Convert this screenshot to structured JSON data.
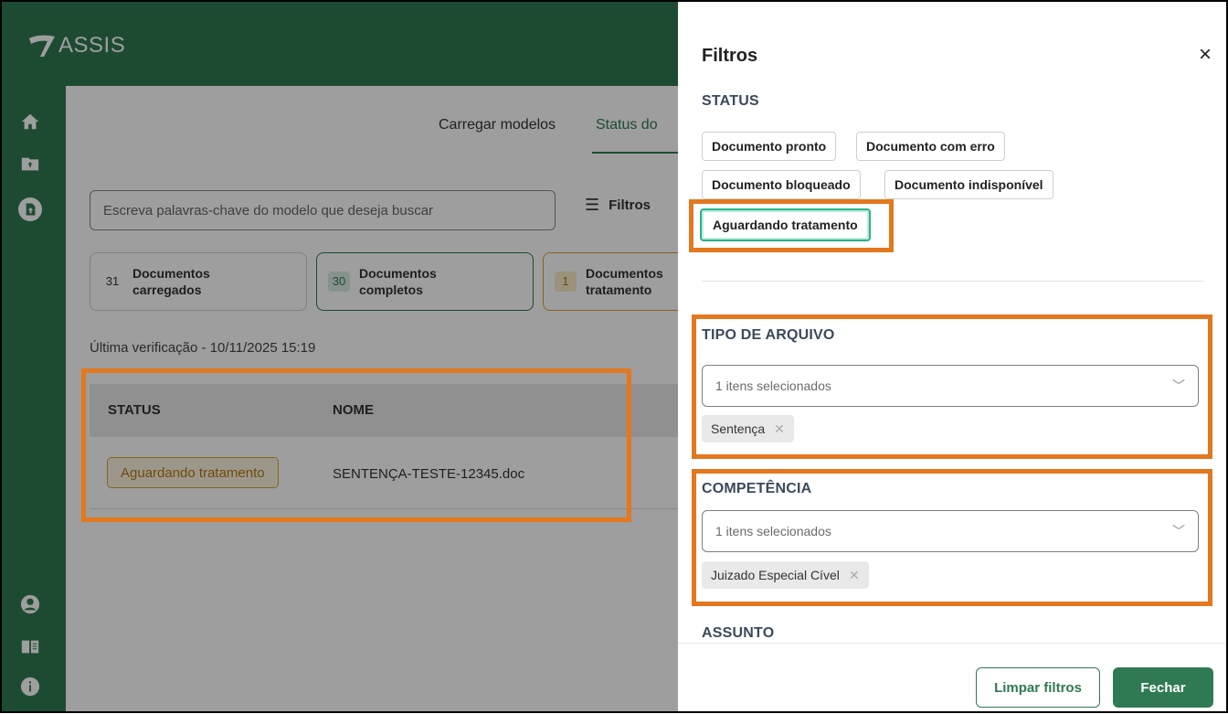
{
  "app": {
    "logo_text": "ASSIS",
    "tabs": [
      {
        "label": "Carregar modelos"
      },
      {
        "label": "Status do"
      }
    ],
    "search": {
      "placeholder": "Escreva palavras-chave do modelo que deseja buscar"
    },
    "filters_button": "Filtros",
    "cards": [
      {
        "count": "31",
        "label_line1": "Documentos",
        "label_line2": "carregados"
      },
      {
        "count": "30",
        "label_line1": "Documentos",
        "label_line2": "completos"
      },
      {
        "count": "1",
        "label_line1": "Documentos",
        "label_line2": "tratamento"
      }
    ],
    "last_check": "Última verificação - 10/11/2025 15:19",
    "table": {
      "headers": [
        "STATUS",
        "NOME"
      ],
      "rows": [
        {
          "status": "Aguardando tratamento",
          "name": "SENTENÇA-TESTE-12345.doc"
        }
      ]
    },
    "rail_icons": [
      "home-icon",
      "folder-upload-icon",
      "document-upload-icon",
      "user-icon",
      "book-icon",
      "info-icon"
    ]
  },
  "drawer": {
    "title": "Filtros",
    "close_icon": "close-icon",
    "status": {
      "title": "STATUS",
      "chips": [
        {
          "label": "Documento pronto",
          "selected": false
        },
        {
          "label": "Documento com erro",
          "selected": false
        },
        {
          "label": "Documento bloqueado",
          "selected": false
        },
        {
          "label": "Documento indisponível",
          "selected": false
        },
        {
          "label": "Aguardando tratamento",
          "selected": true
        }
      ]
    },
    "tipo_arquivo": {
      "title": "TIPO DE ARQUIVO",
      "select_text": "1 itens selecionados",
      "tags": [
        "Sentença"
      ]
    },
    "competencia": {
      "title": "COMPETÊNCIA",
      "select_text": "1 itens selecionados",
      "tags": [
        "Juizado Especial Cível"
      ]
    },
    "assunto": {
      "title": "ASSUNTO"
    },
    "buttons": {
      "clear": "Limpar filtros",
      "close": "Fechar"
    }
  },
  "colors": {
    "brand_green": "#2f7a52",
    "highlight_orange": "#e3781e",
    "pending_amber": "#d9a12b",
    "selected_teal": "#28b38a"
  }
}
